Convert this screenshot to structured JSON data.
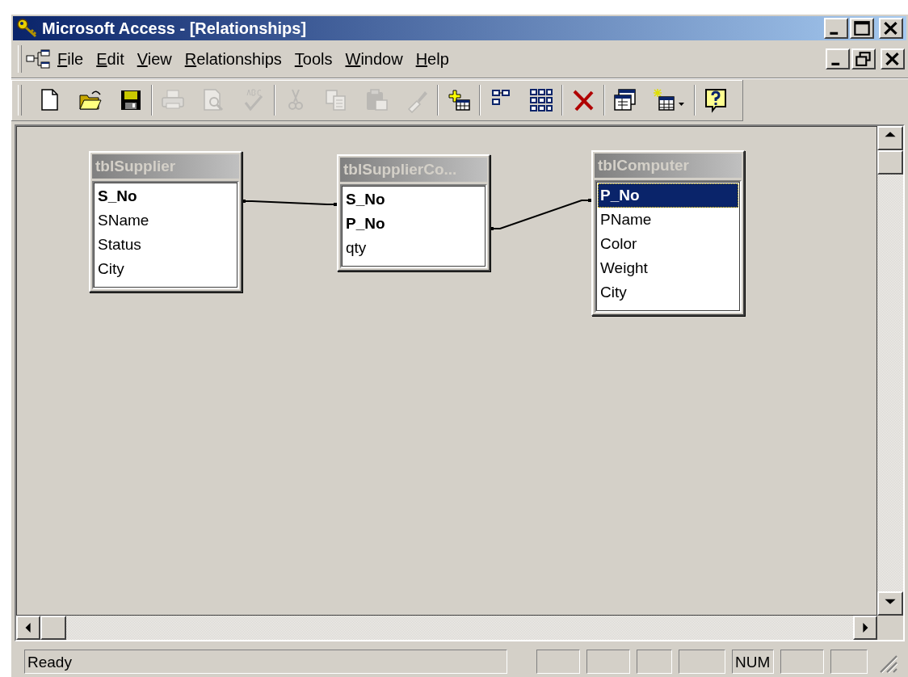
{
  "window": {
    "title": "Microsoft Access - [Relationships]"
  },
  "menu": [
    {
      "label": "File"
    },
    {
      "label": "Edit"
    },
    {
      "label": "View"
    },
    {
      "label": "Relationships"
    },
    {
      "label": "Tools"
    },
    {
      "label": "Window"
    },
    {
      "label": "Help"
    }
  ],
  "toolbar": [
    [
      {
        "kind": "new",
        "disabled": false
      },
      {
        "kind": "open",
        "disabled": false
      },
      {
        "kind": "save",
        "disabled": false
      }
    ],
    [
      {
        "kind": "print",
        "disabled": true
      },
      {
        "kind": "preview",
        "disabled": true
      },
      {
        "kind": "spelling",
        "disabled": true
      }
    ],
    [
      {
        "kind": "cut",
        "disabled": true
      },
      {
        "kind": "copy",
        "disabled": true
      },
      {
        "kind": "paste",
        "disabled": true
      },
      {
        "kind": "painter",
        "disabled": true
      }
    ],
    [
      {
        "kind": "show-table",
        "disabled": false
      }
    ],
    [
      {
        "kind": "direct",
        "disabled": false
      },
      {
        "kind": "all",
        "disabled": false
      }
    ],
    [
      {
        "kind": "delete",
        "disabled": false
      }
    ],
    [
      {
        "kind": "database-window",
        "disabled": false
      },
      {
        "kind": "new-object",
        "disabled": false
      }
    ],
    [
      {
        "kind": "help",
        "disabled": false
      }
    ]
  ],
  "tables": [
    {
      "title": "tblSupplier",
      "active": false,
      "fields": [
        {
          "name": "S_No",
          "key": true,
          "selected": false
        },
        {
          "name": "SName",
          "key": false,
          "selected": false
        },
        {
          "name": "Status",
          "key": false,
          "selected": false
        },
        {
          "name": "City",
          "key": false,
          "selected": false
        }
      ]
    },
    {
      "title": "tblSupplierCo...",
      "active": false,
      "fields": [
        {
          "name": "S_No",
          "key": true,
          "selected": false
        },
        {
          "name": "P_No",
          "key": true,
          "selected": false
        },
        {
          "name": "qty",
          "key": false,
          "selected": false
        }
      ]
    },
    {
      "title": "tblComputer",
      "active": false,
      "fields": [
        {
          "name": "P_No",
          "key": true,
          "selected": true
        },
        {
          "name": "PName",
          "key": false,
          "selected": false
        },
        {
          "name": "Color",
          "key": false,
          "selected": false
        },
        {
          "name": "Weight",
          "key": false,
          "selected": false
        },
        {
          "name": "City",
          "key": false,
          "selected": false
        }
      ]
    }
  ],
  "status_bar": {
    "message": "Ready",
    "indicators": [
      "NUM"
    ]
  }
}
